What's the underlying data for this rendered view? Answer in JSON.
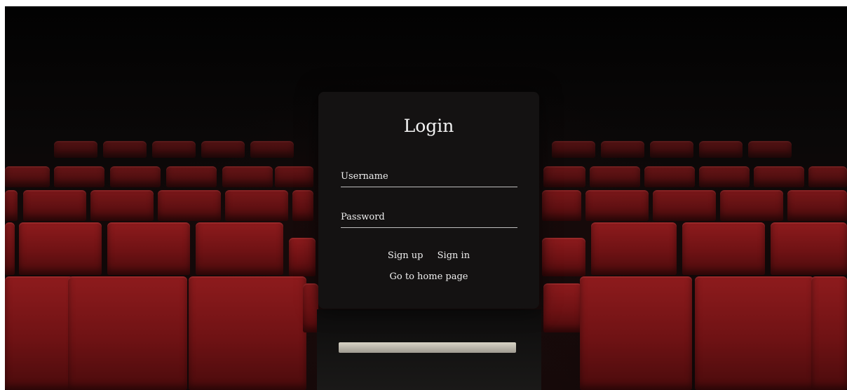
{
  "login": {
    "title": "Login",
    "username_placeholder": "Username",
    "password_placeholder": "Password",
    "signup_label": "Sign up",
    "signin_label": "Sign in",
    "home_link": "Go to home page"
  },
  "theme": {
    "card_bg": "#141212",
    "seat_red": "#8e1b1d",
    "text": "#f0f0f0"
  }
}
